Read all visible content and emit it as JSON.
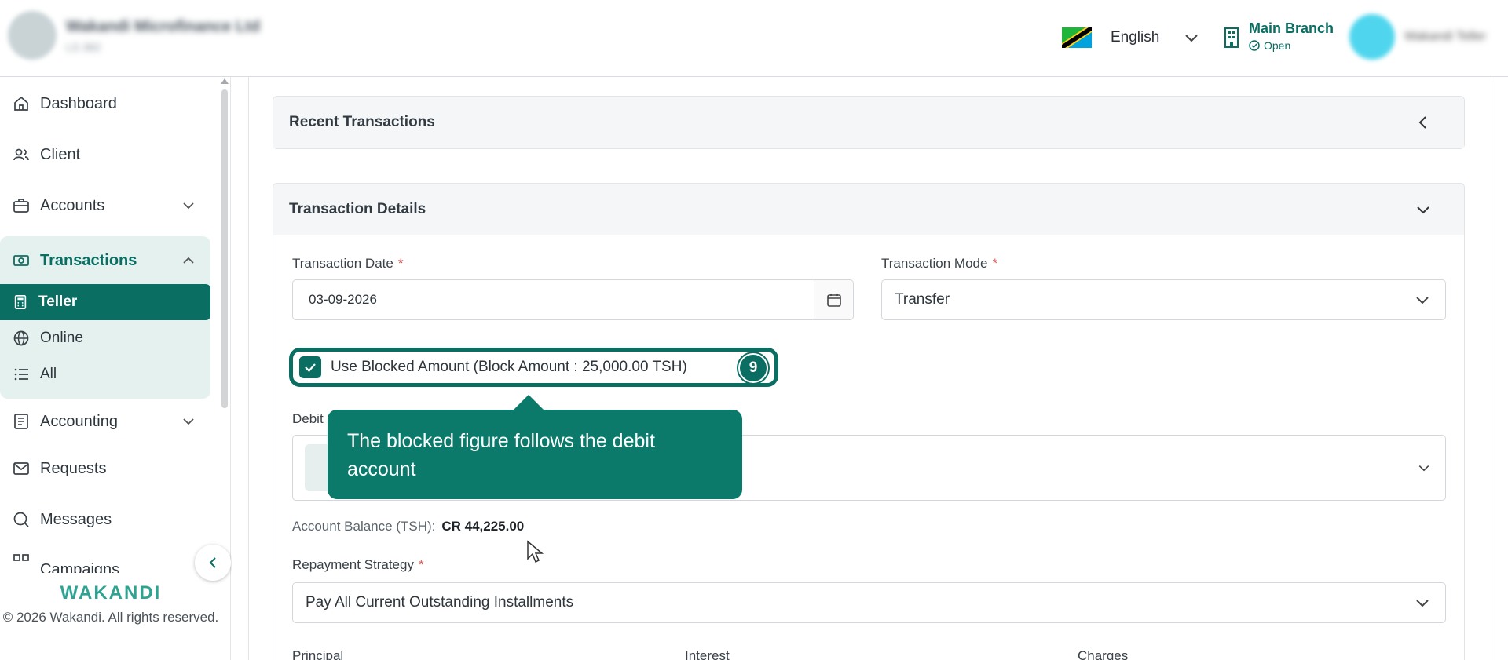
{
  "header": {
    "org_name": "Wakandi Microfinance Ltd",
    "org_sub": "LS 382",
    "language": "English",
    "branch_name": "Main Branch",
    "branch_status": "Open",
    "user_name": "Wakandi Teller"
  },
  "sidebar": {
    "items": [
      {
        "label": "Dashboard",
        "icon": "home-icon"
      },
      {
        "label": "Client",
        "icon": "users-icon"
      },
      {
        "label": "Accounts",
        "icon": "briefcase-icon"
      },
      {
        "label": "Transactions",
        "icon": "money-icon"
      },
      {
        "label": "Teller",
        "icon": "calculator-icon"
      },
      {
        "label": "Online",
        "icon": "globe-icon"
      },
      {
        "label": "All",
        "icon": "list-icon"
      },
      {
        "label": "Accounting",
        "icon": "ledger-icon"
      },
      {
        "label": "Requests",
        "icon": "mail-icon"
      },
      {
        "label": "Messages",
        "icon": "chat-icon"
      },
      {
        "label": "Campaigns",
        "icon": "grid-icon"
      }
    ],
    "brand": "WAKANDI",
    "copyright": "© 2026 Wakandi. All rights reserved."
  },
  "main": {
    "recent_title": "Recent Transactions",
    "details_title": "Transaction Details",
    "date_label": "Transaction Date",
    "date_value": "03-09-2026",
    "mode_label": "Transaction Mode",
    "mode_value": "Transfer",
    "blocked_label": "Use Blocked Amount (Block Amount : 25,000.00 TSH)",
    "step_number": "9",
    "debit_label": "Debit",
    "tooltip": "The blocked figure follows the debit account",
    "balance_label": "Account Balance (TSH):",
    "balance_value": "CR 44,225.00",
    "strategy_label": "Repayment Strategy",
    "strategy_value": "Pay All Current Outstanding Installments",
    "col_principal": "Principal",
    "col_interest": "Interest",
    "col_charges": "Charges",
    "required_mark": "*"
  },
  "colors": {
    "accent": "#0b6e63",
    "tooltip": "#0b7a6b",
    "active_bg": "#e5f1ef"
  }
}
